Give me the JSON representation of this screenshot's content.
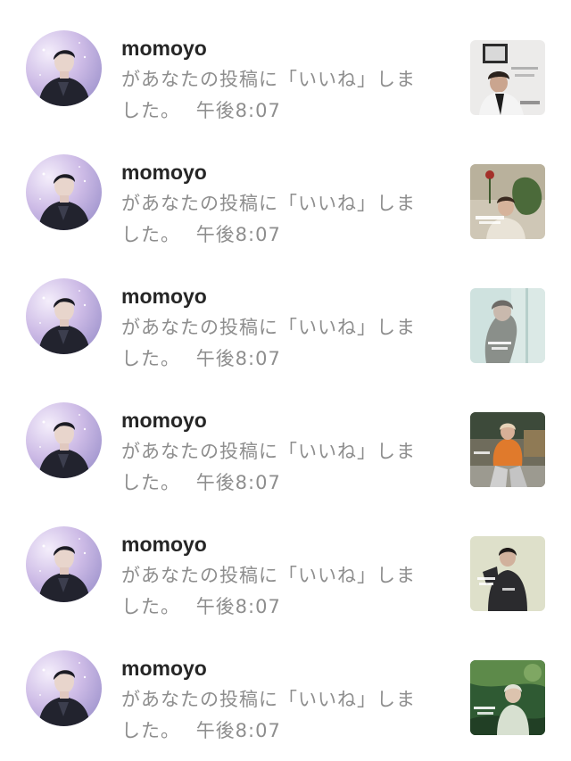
{
  "notifications": [
    {
      "username": "momoyo",
      "message": "があなたの投稿に「いいね」しました。",
      "time": "午後8:07",
      "thumb_theme": "gray-room"
    },
    {
      "username": "momoyo",
      "message": "があなたの投稿に「いいね」しました。",
      "time": "午後8:07",
      "thumb_theme": "warm-green"
    },
    {
      "username": "momoyo",
      "message": "があなたの投稿に「いいね」しました。",
      "time": "午後8:07",
      "thumb_theme": "pale-teal"
    },
    {
      "username": "momoyo",
      "message": "があなたの投稿に「いいね」しました。",
      "time": "午後8:07",
      "thumb_theme": "orange-street"
    },
    {
      "username": "momoyo",
      "message": "があなたの投稿に「いいね」しました。",
      "time": "午後8:07",
      "thumb_theme": "light-olive"
    },
    {
      "username": "momoyo",
      "message": "があなたの投稿に「いいね」しました。",
      "time": "午後8:07",
      "thumb_theme": "deep-green"
    }
  ],
  "colors": {
    "username": "#262626",
    "message": "#8e8e8e",
    "background": "#ffffff"
  },
  "icons": {
    "avatar": "person-avatar-icon",
    "thumbnail": "post-thumbnail-image"
  }
}
